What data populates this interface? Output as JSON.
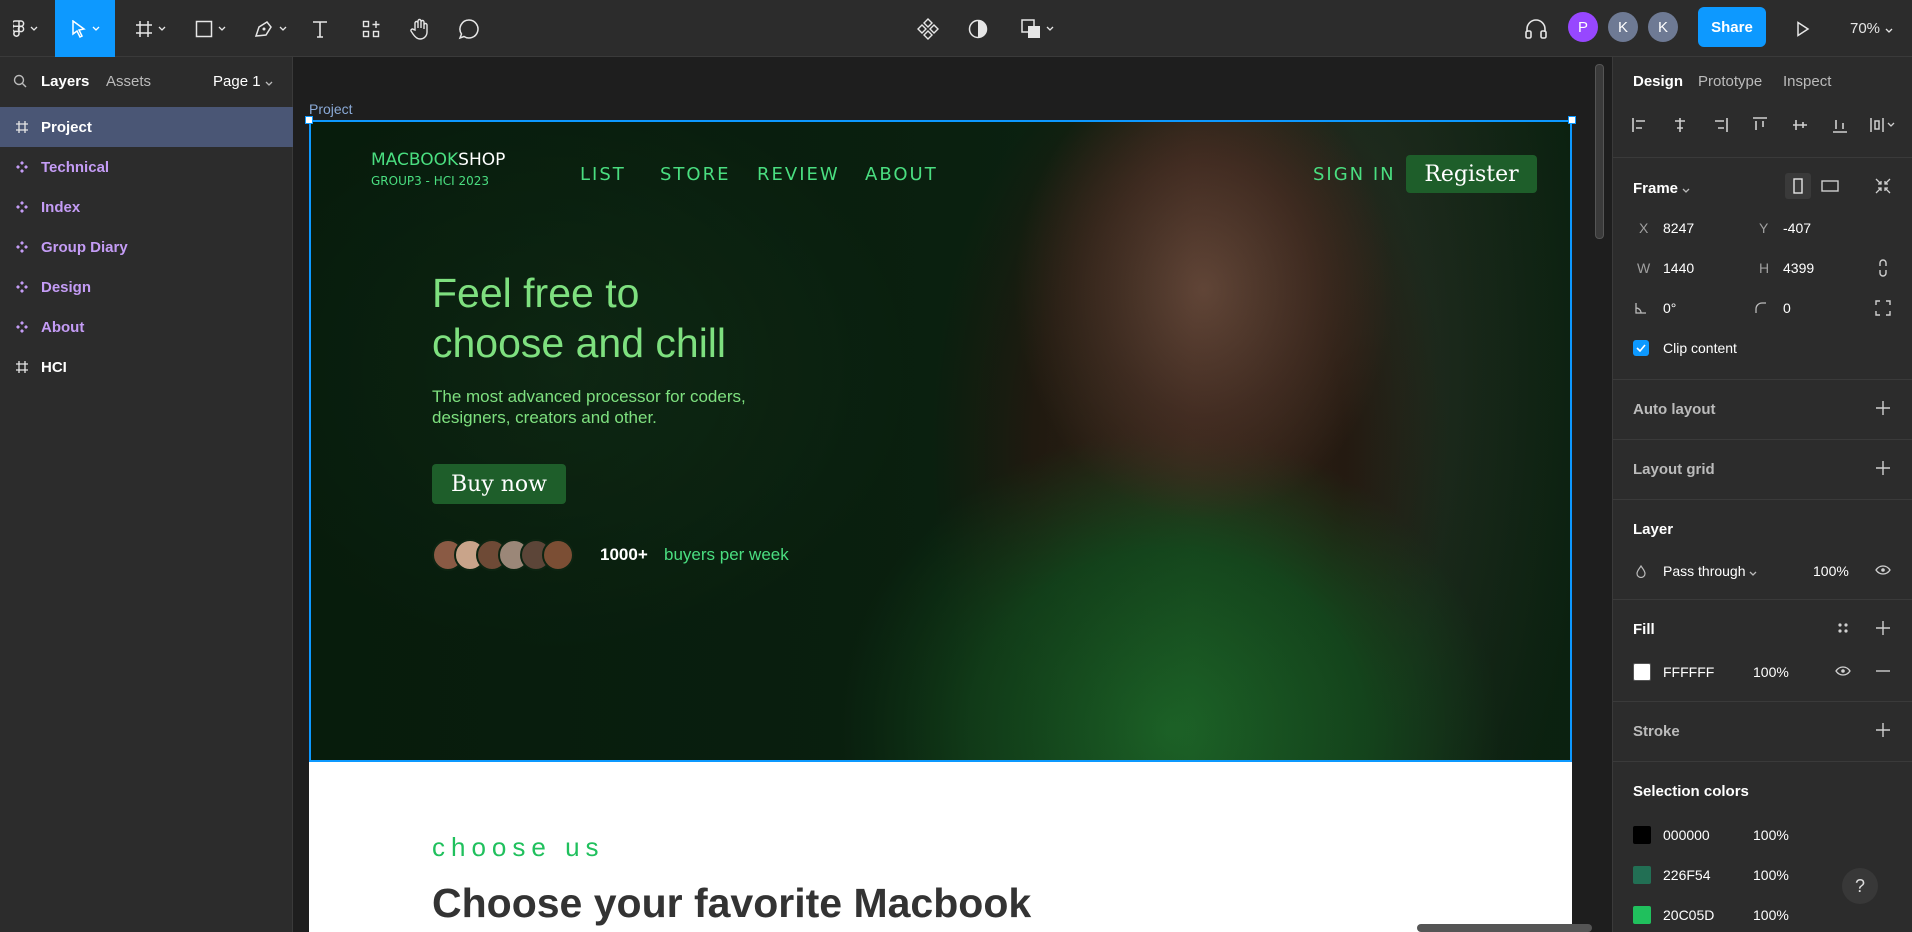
{
  "toolbar": {
    "share_label": "Share",
    "zoom": "70%",
    "avatars": [
      {
        "initial": "P",
        "color": "#9747ff"
      },
      {
        "initial": "K",
        "color": "#6e7a94"
      },
      {
        "initial": "K",
        "color": "#6e7a94"
      }
    ]
  },
  "left_panel": {
    "tabs": {
      "layers": "Layers",
      "assets": "Assets",
      "page": "Page 1"
    },
    "layers": [
      {
        "label": "Project",
        "type": "frame",
        "selected": true
      },
      {
        "label": "Technical",
        "type": "component",
        "selected": false
      },
      {
        "label": "Index",
        "type": "component",
        "selected": false
      },
      {
        "label": "Group Diary",
        "type": "component",
        "selected": false
      },
      {
        "label": "Design",
        "type": "component",
        "selected": false
      },
      {
        "label": "About",
        "type": "component",
        "selected": false
      },
      {
        "label": "HCI",
        "type": "frame",
        "selected": false
      }
    ]
  },
  "canvas": {
    "frame_label": "Project",
    "hero": {
      "logo_green": "MACBOOK",
      "logo_white": "SHOP",
      "logo_sub": "GROUP3 - HCI 2023",
      "nav": [
        "LIST",
        "STORE",
        "REVIEW",
        "ABOUT"
      ],
      "sign_in": "SIGN IN",
      "register": "Register",
      "headline_1": "Feel free to",
      "headline_2": "choose and chill",
      "description": "The most advanced processor for coders, designers, creators and other.",
      "buy_now": "Buy now",
      "stat_number": "1000+",
      "stat_text": "buyers per week"
    },
    "section2": {
      "kicker": "choose us",
      "heading": "Choose your favorite Macbook"
    }
  },
  "right_panel": {
    "tabs": {
      "design": "Design",
      "prototype": "Prototype",
      "inspect": "Inspect"
    },
    "frame": {
      "title": "Frame",
      "x_label": "X",
      "x": "8247",
      "y_label": "Y",
      "y": "-407",
      "w_label": "W",
      "w": "1440",
      "h_label": "H",
      "h": "4399",
      "rotation": "0°",
      "radius": "0",
      "clip_content": "Clip content"
    },
    "auto_layout": "Auto layout",
    "layout_grid": "Layout grid",
    "layer": {
      "title": "Layer",
      "blend": "Pass through",
      "opacity": "100%"
    },
    "fill": {
      "title": "Fill",
      "hex": "FFFFFF",
      "opacity": "100%",
      "color": "#FFFFFF"
    },
    "stroke": "Stroke",
    "selection_colors": {
      "title": "Selection colors",
      "items": [
        {
          "hex": "000000",
          "opacity": "100%",
          "color": "#000000"
        },
        {
          "hex": "226F54",
          "opacity": "100%",
          "color": "#226F54"
        },
        {
          "hex": "20C05D",
          "opacity": "100%",
          "color": "#20C05D"
        }
      ]
    }
  },
  "help_label": "?"
}
